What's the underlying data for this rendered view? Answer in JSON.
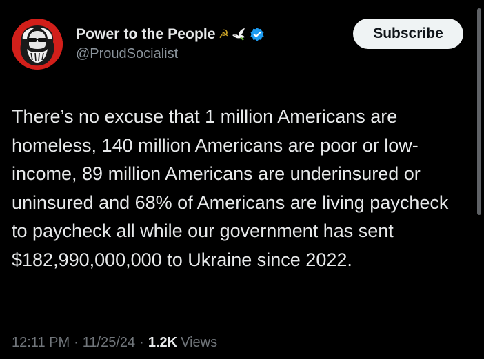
{
  "author": {
    "display_name": "Power to the People",
    "name_emojis": [
      "hammer-and-sickle",
      "dove"
    ],
    "sickle_glyph": "☭",
    "handle": "@ProudSocialist",
    "verified": true,
    "avatar_bg": "#d21f1a"
  },
  "subscribe_label": "Subscribe",
  "post": {
    "text": "There’s no excuse that 1 million Americans are homeless, 140 million Americans are poor or low-income, 89 million Americans are underinsured or uninsured and 68% of Americans are living paycheck to paycheck all while our government has sent $182,990,000,000 to Ukraine since 2022."
  },
  "meta": {
    "time": "12:11 PM",
    "date": "11/25/24",
    "separator": "·",
    "views_count": "1.2K",
    "views_label": "Views"
  },
  "colors": {
    "background": "#000000",
    "text_primary": "#e7e9ea",
    "text_secondary": "#71767b",
    "verified_blue": "#1d9bf0",
    "button_bg": "#eff3f4"
  }
}
